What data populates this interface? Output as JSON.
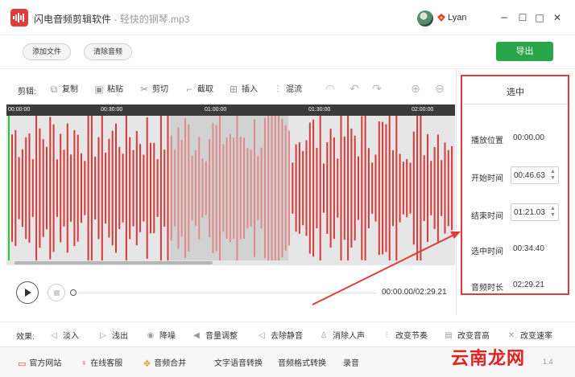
{
  "app": {
    "name": "闪电音频剪辑软件",
    "separator": " - ",
    "file": "轻快的钢琴.mp3",
    "username": "Lyan"
  },
  "window": {
    "minimize": "─",
    "maximize": "☐",
    "close": "✕"
  },
  "top_buttons": {
    "add_file": "添加文件",
    "clear_audio": "清除音频",
    "export": "导出"
  },
  "edit_toolbar": {
    "label": "剪辑:",
    "tools": [
      {
        "label": "复制",
        "icon": "copy-icon"
      },
      {
        "label": "粘贴",
        "icon": "paste-icon"
      },
      {
        "label": "剪切",
        "icon": "scissors-icon"
      },
      {
        "label": "截取",
        "icon": "crop-icon"
      },
      {
        "label": "插入",
        "icon": "insert-icon"
      },
      {
        "label": "混流",
        "icon": "mix-icon"
      }
    ],
    "icon_tools": [
      "headphones-icon",
      "undo-icon",
      "redo-icon",
      "zoom-in-icon",
      "zoom-out-icon"
    ]
  },
  "timeline": {
    "ticks": [
      "00:00:00",
      "00:30:00",
      "01:00:00",
      "01:30:00",
      "02:00:00"
    ],
    "total_seconds": 149.21,
    "selection_start_seconds": 46.63,
    "selection_end_seconds": 81.03,
    "playhead_seconds": 0
  },
  "player": {
    "time": "00:00.00/02:29.21"
  },
  "panel": {
    "title": "选中",
    "play_position_label": "播放位置",
    "play_position_value": "00:00.00",
    "start_label": "开始时间",
    "start_value": "00:46.63",
    "end_label": "结束时间",
    "end_value": "01:21.03",
    "selected_label": "选中时间",
    "selected_value": "00:34.40",
    "duration_label": "音频时长",
    "duration_value": "02:29.21"
  },
  "effects": {
    "label": "效果:",
    "items": [
      {
        "label": "淡入",
        "icon": "fade-in-icon"
      },
      {
        "label": "浅出",
        "icon": "fade-out-icon"
      },
      {
        "label": "降噪",
        "icon": "denoise-icon"
      },
      {
        "label": "音量调整",
        "icon": "volume-icon"
      },
      {
        "label": "去除静音",
        "icon": "mute-icon"
      },
      {
        "label": "消除人声",
        "icon": "vocal-remove-icon"
      },
      {
        "label": "改变节奏",
        "icon": "tempo-icon"
      },
      {
        "label": "改变音高",
        "icon": "pitch-icon"
      },
      {
        "label": "改变速率",
        "icon": "speed-icon"
      }
    ]
  },
  "footer": {
    "items": [
      "官方网站",
      "在线客服",
      "音频合并",
      "文字语音转换",
      "音频格式转换",
      "录音"
    ],
    "version": "1.4"
  },
  "watermark": "云南龙网",
  "colors": {
    "accent": "#2aa64a",
    "wave": "#d43a3a",
    "highlight": "#e03a3a",
    "playhead": "#33c43c"
  }
}
